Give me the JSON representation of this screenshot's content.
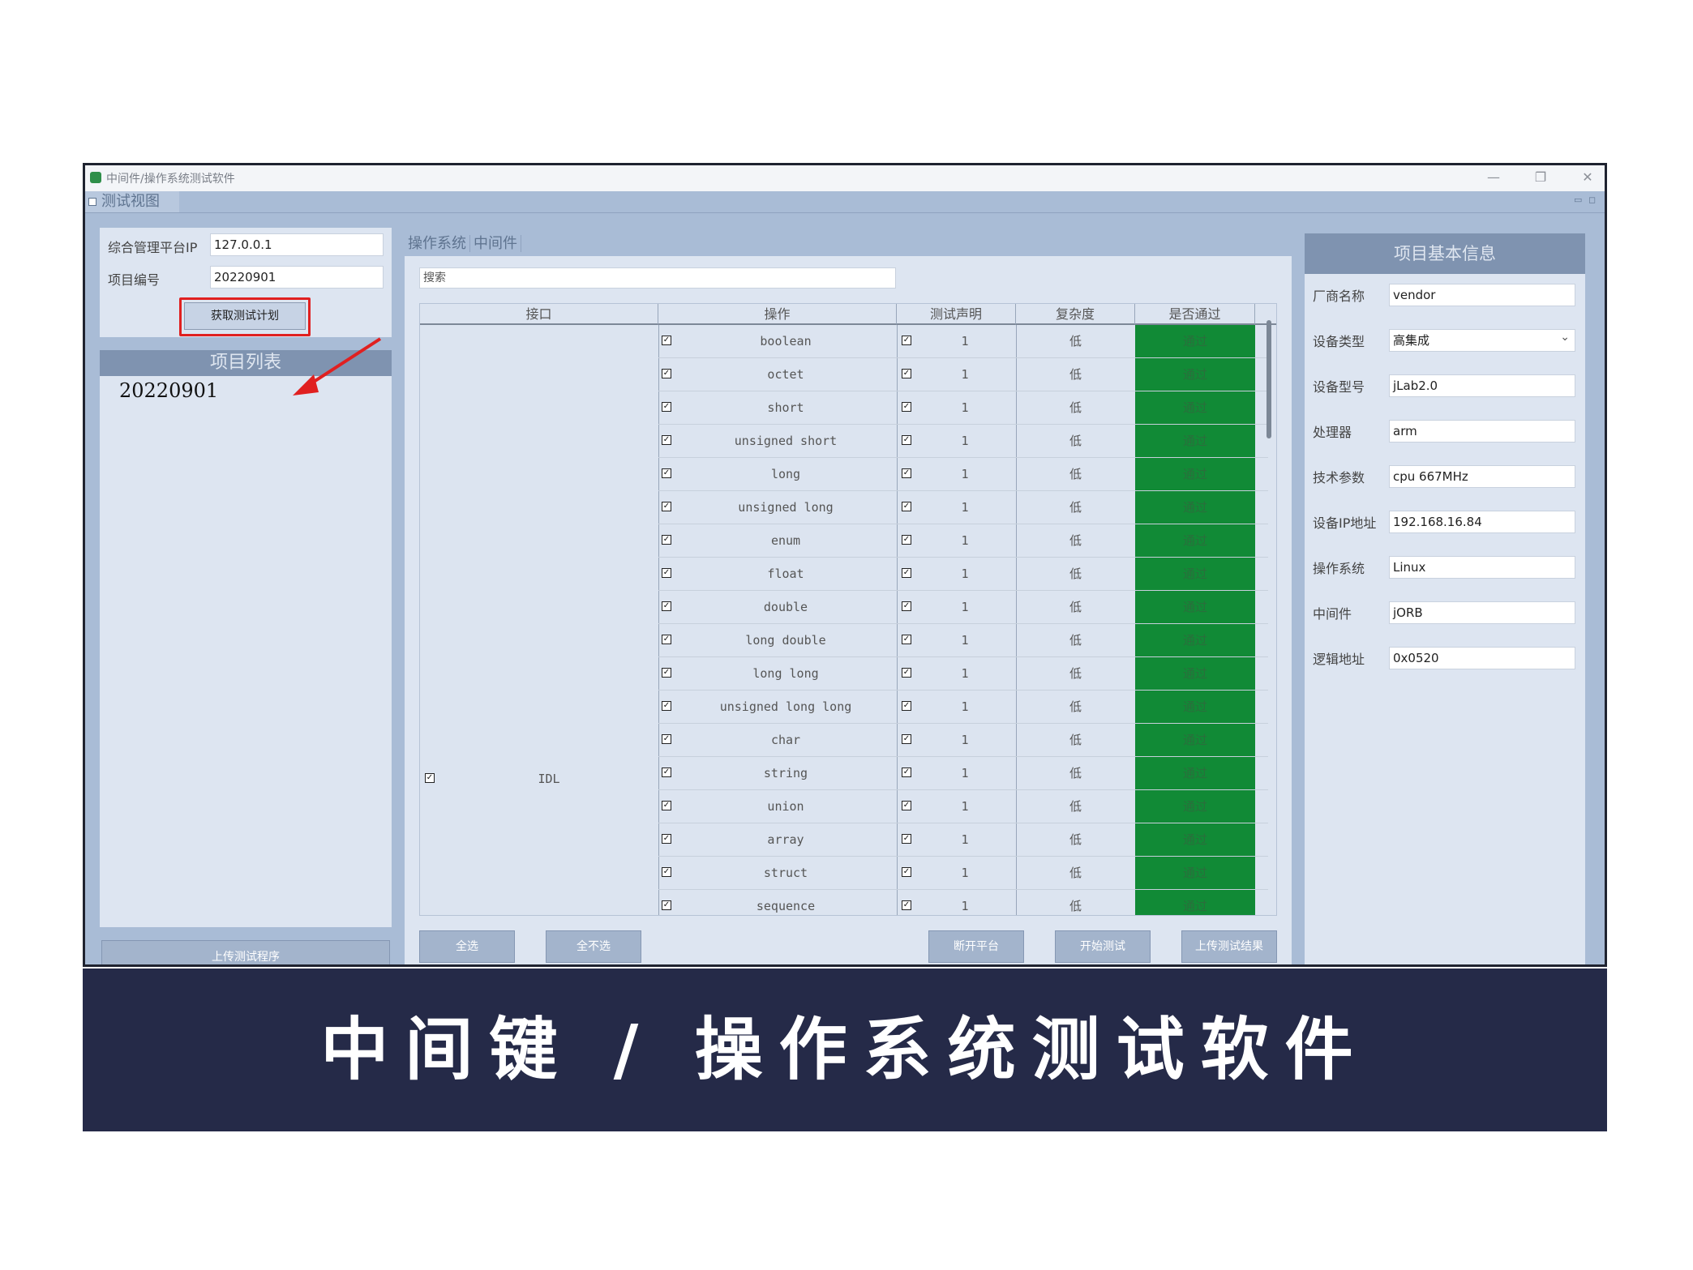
{
  "window": {
    "title": "中间件/操作系统测试软件",
    "min": "—",
    "restore": "❐",
    "close": "✕"
  },
  "view_tab": "测试视图",
  "left": {
    "ip_label": "综合管理平台IP",
    "ip_value": "127.0.0.1",
    "project_no_label": "项目编号",
    "project_no_value": "20220901",
    "fetch_button": "获取测试计划",
    "project_list_header": "项目列表",
    "project_list": [
      "20220901"
    ],
    "upload_program_button": "上传测试程序"
  },
  "center": {
    "tabs": [
      "操作系统",
      "中间件"
    ],
    "search_placeholder": "搜索",
    "columns": [
      "接口",
      "操作",
      "测试声明",
      "复杂度",
      "是否通过"
    ],
    "interface": {
      "name": "IDL",
      "checked": true
    },
    "rows": [
      {
        "op": "boolean",
        "decl": "1",
        "complexity": "低",
        "passed": "通过"
      },
      {
        "op": "octet",
        "decl": "1",
        "complexity": "低",
        "passed": "通过"
      },
      {
        "op": "short",
        "decl": "1",
        "complexity": "低",
        "passed": "通过"
      },
      {
        "op": "unsigned short",
        "decl": "1",
        "complexity": "低",
        "passed": "通过"
      },
      {
        "op": "long",
        "decl": "1",
        "complexity": "低",
        "passed": "通过"
      },
      {
        "op": "unsigned long",
        "decl": "1",
        "complexity": "低",
        "passed": "通过"
      },
      {
        "op": "enum",
        "decl": "1",
        "complexity": "低",
        "passed": "通过"
      },
      {
        "op": "float",
        "decl": "1",
        "complexity": "低",
        "passed": "通过"
      },
      {
        "op": "double",
        "decl": "1",
        "complexity": "低",
        "passed": "通过"
      },
      {
        "op": "long double",
        "decl": "1",
        "complexity": "低",
        "passed": "通过"
      },
      {
        "op": "long long",
        "decl": "1",
        "complexity": "低",
        "passed": "通过"
      },
      {
        "op": "unsigned long long",
        "decl": "1",
        "complexity": "低",
        "passed": "通过"
      },
      {
        "op": "char",
        "decl": "1",
        "complexity": "低",
        "passed": "通过"
      },
      {
        "op": "string",
        "decl": "1",
        "complexity": "低",
        "passed": "通过"
      },
      {
        "op": "union",
        "decl": "1",
        "complexity": "低",
        "passed": "通过"
      },
      {
        "op": "array",
        "decl": "1",
        "complexity": "低",
        "passed": "通过"
      },
      {
        "op": "struct",
        "decl": "1",
        "complexity": "低",
        "passed": "通过"
      },
      {
        "op": "sequence",
        "decl": "1",
        "complexity": "低",
        "passed": "通过"
      }
    ],
    "buttons": {
      "select_all": "全选",
      "select_none": "全不选",
      "disconnect": "断开平台",
      "start_test": "开始测试",
      "upload_result": "上传测试结果"
    }
  },
  "right": {
    "header": "项目基本信息",
    "fields": [
      {
        "label": "厂商名称",
        "value": "vendor"
      },
      {
        "label": "设备类型",
        "value": "高集成",
        "dropdown": true
      },
      {
        "label": "设备型号",
        "value": "jLab2.0"
      },
      {
        "label": "处理器",
        "value": "arm"
      },
      {
        "label": "技术参数",
        "value": "cpu 667MHz"
      },
      {
        "label": "设备IP地址",
        "value": "192.168.16.84"
      },
      {
        "label": "操作系统",
        "value": "Linux"
      },
      {
        "label": "中间件",
        "value": "jORB"
      },
      {
        "label": "逻辑地址",
        "value": "0x0520"
      }
    ]
  },
  "caption": "中间键 / 操作系统测试软件",
  "colors": {
    "pass_green": "#118a36",
    "caption_bg": "#252a48",
    "highlight_red": "#e02020"
  }
}
